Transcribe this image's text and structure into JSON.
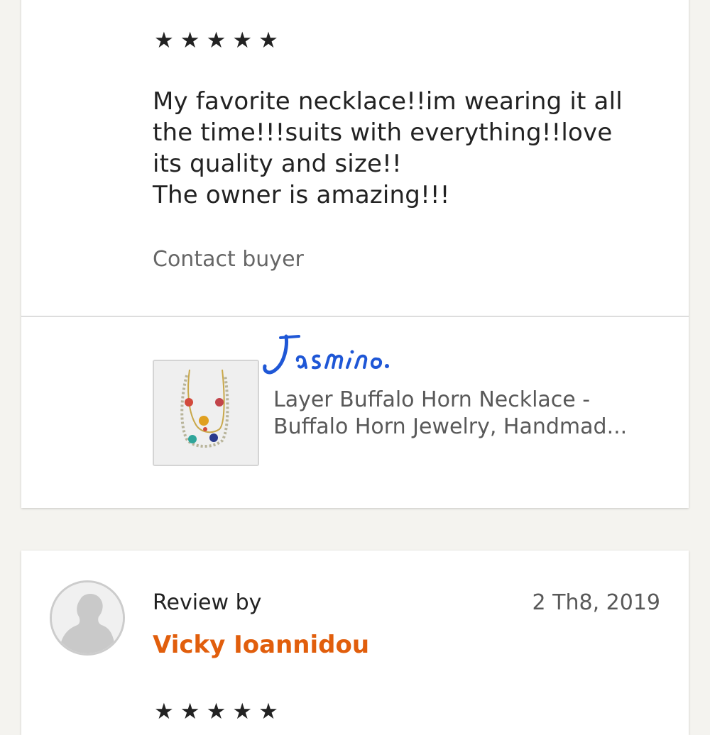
{
  "review_1": {
    "rating": 5,
    "stars": "★★★★★",
    "text_lines": [
      "My favorite necklace!!im wearing it all",
      "the time!!!suits with everything!!love",
      "its quality and size!!",
      "The owner is amazing!!!"
    ],
    "contact_label": "Contact buyer",
    "product": {
      "brand_signature": "Jasmino",
      "title_lines": [
        "Layer Buffalo Horn Necklace -",
        "Buffalo Horn Jewelry, Handmad..."
      ],
      "brand_color": "#1f57d6"
    }
  },
  "review_2": {
    "label": "Review by",
    "reviewer_name": "Vicky Ioannidou",
    "date": "2 Th8, 2019",
    "stars": "★★★★★",
    "name_color": "#e15e0c"
  },
  "colors": {
    "page_background": "#f4f3ef",
    "card_background": "#ffffff",
    "text": "#222222",
    "muted_text": "#666666",
    "accent": "#e15e0c"
  },
  "icons": {
    "rating": "star-icon",
    "avatar": "default-user-avatar-icon",
    "product_thumbnail": "necklace-image"
  }
}
